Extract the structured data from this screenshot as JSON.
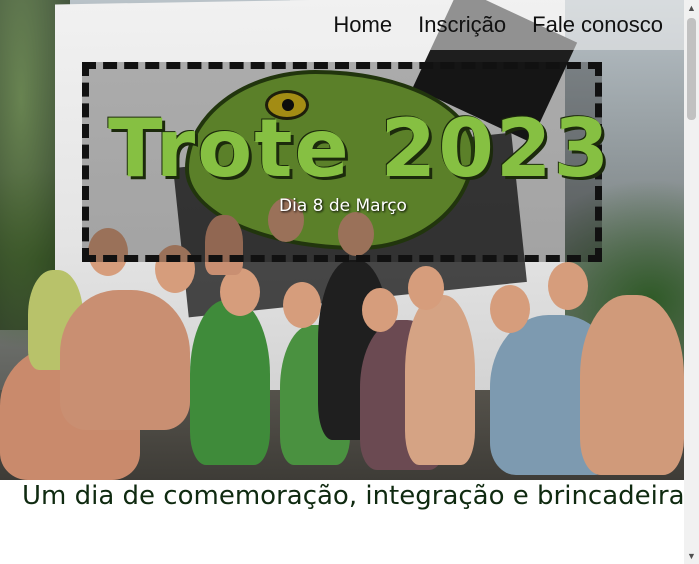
{
  "nav": {
    "items": [
      {
        "label": "Home"
      },
      {
        "label": "Inscrição"
      },
      {
        "label": "Fale conosco"
      }
    ]
  },
  "hero": {
    "title": "Trote 2023",
    "date": "Dia 8 de Março"
  },
  "tagline": "Um dia de comemoração, integração e brincadeiras",
  "scrollbar": {
    "up_icon": "chevron-up-icon",
    "down_icon": "chevron-down-icon"
  },
  "colors": {
    "title_green": "#86c042",
    "tagline_text": "#0f2a10"
  }
}
